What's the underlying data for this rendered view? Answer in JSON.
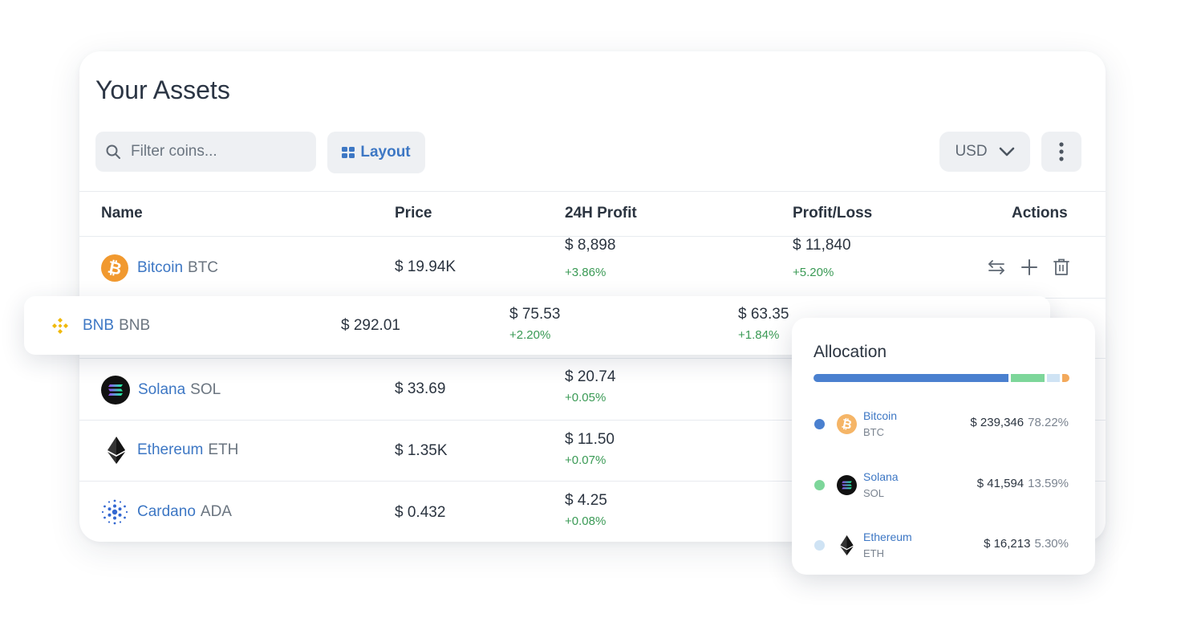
{
  "panel": {
    "title": "Your Assets"
  },
  "toolbar": {
    "search_placeholder": "Filter coins...",
    "layout_label": "Layout",
    "currency": "USD"
  },
  "table": {
    "headers": {
      "name": "Name",
      "price": "Price",
      "profit24h": "24H Profit",
      "profitloss": "Profit/Loss",
      "actions": "Actions"
    },
    "rows": [
      {
        "name": "Bitcoin",
        "symbol": "BTC",
        "icon": "bitcoin-icon",
        "price": "$ 19.94K",
        "profit24h": "$ 8,898",
        "profit24h_pct": "+3.86%",
        "pl": "$ 11,840",
        "pl_pct": "+5.20%"
      },
      {
        "name": "BNB",
        "symbol": "BNB",
        "icon": "bnb-icon",
        "price": "$ 292.01",
        "profit24h": "$ 75.53",
        "profit24h_pct": "+2.20%",
        "pl": "$ 63.35",
        "pl_pct": "+1.84%"
      },
      {
        "name": "Solana",
        "symbol": "SOL",
        "icon": "solana-icon",
        "price": "$ 33.69",
        "profit24h": "$ 20.74",
        "profit24h_pct": "+0.05%"
      },
      {
        "name": "Ethereum",
        "symbol": "ETH",
        "icon": "ethereum-icon",
        "price": "$ 1.35K",
        "profit24h": "$ 11.50",
        "profit24h_pct": "+0.07%"
      },
      {
        "name": "Cardano",
        "symbol": "ADA",
        "icon": "cardano-icon",
        "price": "$ 0.432",
        "profit24h": "$ 4.25",
        "profit24h_pct": "+0.08%"
      }
    ]
  },
  "allocation": {
    "title": "Allocation",
    "items": [
      {
        "name": "Bitcoin",
        "symbol": "BTC",
        "value": "$ 239,346",
        "pct": "78.22%",
        "color": "#4a80cf"
      },
      {
        "name": "Solana",
        "symbol": "SOL",
        "value": "$ 41,594",
        "pct": "13.59%",
        "color": "#7dd69a"
      },
      {
        "name": "Ethereum",
        "symbol": "ETH",
        "value": "$ 16,213",
        "pct": "5.30%",
        "color": "#cfe3f4"
      }
    ],
    "other_color": "#f3a95b",
    "shares": [
      78.22,
      13.59,
      5.3,
      2.89
    ]
  },
  "colors": {
    "accent": "#3d77c4",
    "positive": "#3a9a55"
  }
}
